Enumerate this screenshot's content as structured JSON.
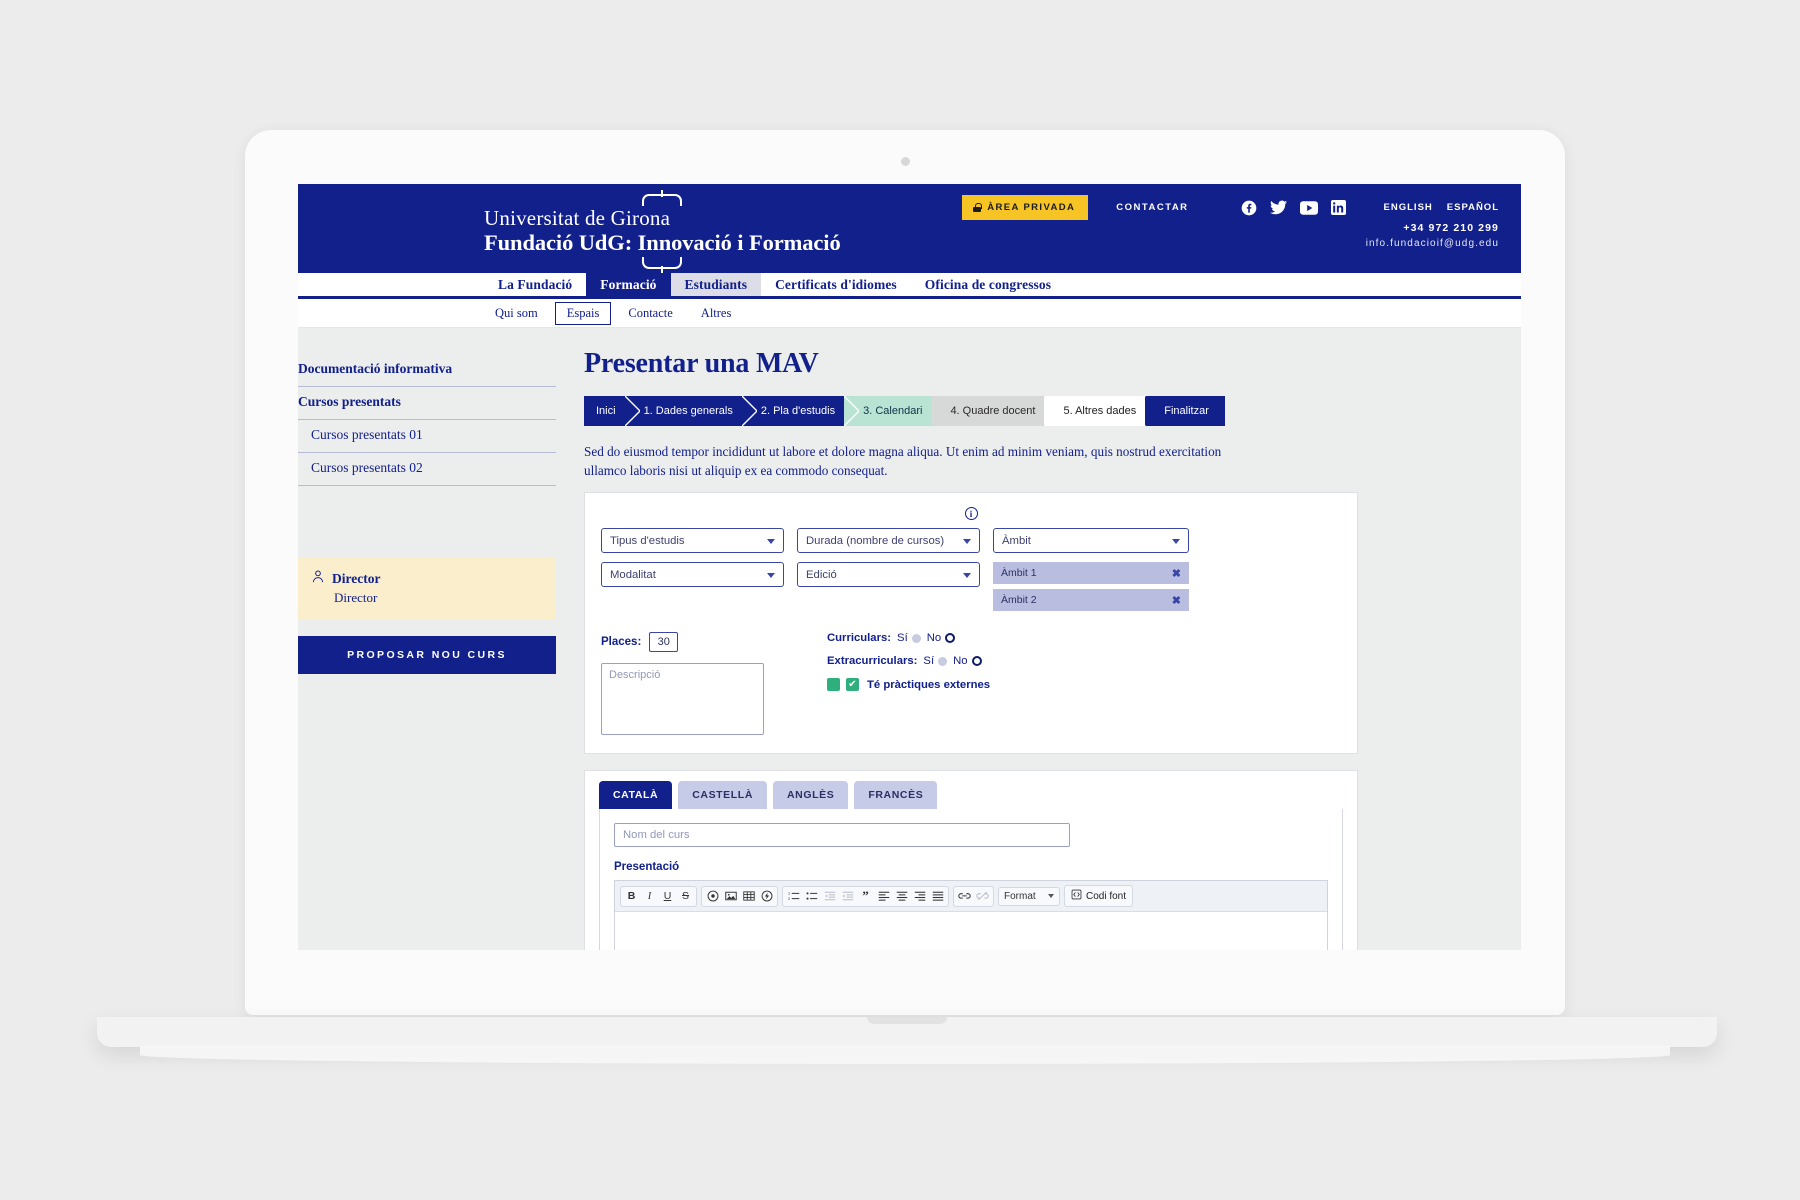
{
  "header": {
    "brand_line1": "Universitat de Girona",
    "brand_line2": "Fundació UdG: Innovació i Formació",
    "area_privada": "ÀREA PRIVADA",
    "contactar": "CONTACTAR",
    "lang_english": "ENGLISH",
    "lang_espanol": "ESPAÑOL",
    "phone": "+34 972 210 299",
    "email": "info.fundacioif@udg.edu",
    "social": [
      "facebook-icon",
      "twitter-icon",
      "youtube-icon",
      "linkedin-icon"
    ]
  },
  "main_nav": [
    {
      "label": "La Fundació",
      "state": "normal"
    },
    {
      "label": "Formació",
      "state": "active"
    },
    {
      "label": "Estudiants",
      "state": "current"
    },
    {
      "label": "Certificats d'idiomes",
      "state": "normal"
    },
    {
      "label": "Oficina de congressos",
      "state": "normal"
    }
  ],
  "sub_nav": [
    {
      "label": "Qui som",
      "boxed": false
    },
    {
      "label": "Espais",
      "boxed": true
    },
    {
      "label": "Contacte",
      "boxed": false
    },
    {
      "label": "Altres",
      "boxed": false
    }
  ],
  "sidebar": {
    "links": [
      {
        "label": "Documentació informativa",
        "level": "bold"
      },
      {
        "label": "Cursos presentats",
        "level": "bold"
      },
      {
        "label": "Cursos presentats 01",
        "level": "sub"
      },
      {
        "label": "Cursos presentats 02",
        "level": "sub"
      }
    ],
    "director_name": "Director",
    "director_role": "Director",
    "propose_button": "PROPOSAR NOU CURS"
  },
  "main": {
    "title": "Presentar una MAV",
    "wizard": [
      {
        "label": "Inici",
        "state": "done"
      },
      {
        "label": "1. Dades generals",
        "state": "done"
      },
      {
        "label": "2. Pla d'estudis",
        "state": "done"
      },
      {
        "label": "3. Calendari",
        "state": "current"
      },
      {
        "label": "4. Quadre docent",
        "state": "next"
      },
      {
        "label": "5. Altres dades",
        "state": "empty"
      },
      {
        "label": "Finalitzar",
        "state": "last"
      }
    ],
    "intro": "Sed do eiusmod tempor incididunt ut labore et dolore magna aliqua. Ut enim ad minim veniam, quis nostrud exercitation ullamco laboris nisi ut aliquip ex ea commodo consequat.",
    "form": {
      "info_icon": "info-icon",
      "select_tipus": "Tipus d'estudis",
      "select_durada": "Durada (nombre de cursos)",
      "select_ambit": "Àmbit",
      "select_modalitat": "Modalitat",
      "select_edicio": "Edició",
      "chips": [
        "Àmbit 1",
        "Àmbit 2"
      ],
      "chip_remove": "✖",
      "places_label": "Places:",
      "places_value": "30",
      "descripcio_placeholder": "Descripció",
      "curriculars_label": "Curriculars:",
      "extracurriculars_label": "Extracurriculars:",
      "option_si": "Sí",
      "option_no": "No",
      "curriculars_selected": "No",
      "extracurriculars_selected": "No",
      "practiques_label": "Té pràctiques externes",
      "practiques_checked": true
    },
    "tabs": [
      {
        "label": "CATALÀ",
        "active": true
      },
      {
        "label": "CASTELLÀ",
        "active": false
      },
      {
        "label": "ANGLÈS",
        "active": false
      },
      {
        "label": "FRANCÈS",
        "active": false
      }
    ],
    "course_name_placeholder": "Nom del curs",
    "presentacio_label": "Presentació",
    "editor": {
      "group1": [
        "B",
        "I",
        "U",
        "S"
      ],
      "group2": [
        "media-icon",
        "image-icon",
        "table-icon",
        "flash-icon"
      ],
      "group3": [
        "ordered-list-icon",
        "unordered-list-icon",
        "outdent-icon",
        "indent-icon",
        "blockquote-icon",
        "align-left-icon",
        "align-center-icon",
        "align-right-icon",
        "align-justify-icon"
      ],
      "group4": [
        "link-icon",
        "unlink-icon"
      ],
      "format_label": "Format",
      "source_label": "Codi font"
    }
  },
  "colors": {
    "brand_blue": "#12208c",
    "accent_yellow": "#f6c424",
    "current_step": "#b9e3d3",
    "next_step": "#d7d8d8",
    "chip": "#b9bee0",
    "director_card": "#faeecd",
    "check_green": "#2fae7e",
    "page_bg": "#eceded"
  }
}
